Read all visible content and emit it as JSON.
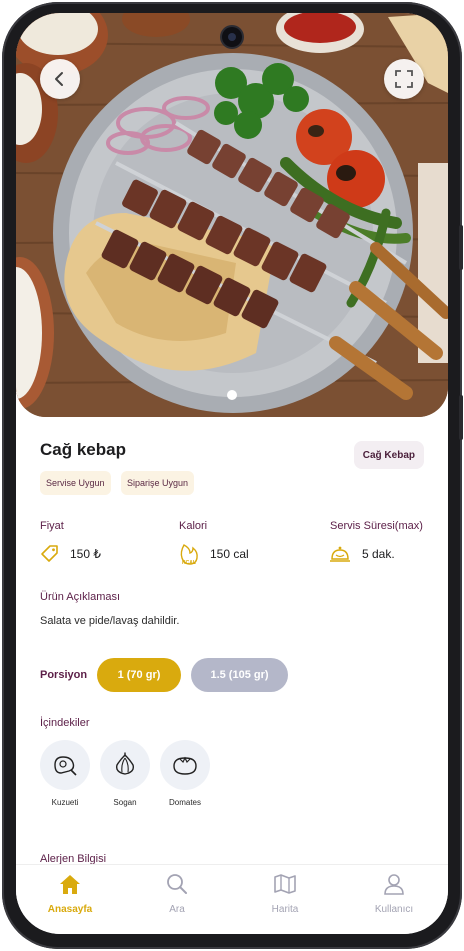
{
  "product": {
    "name": "Cağ kebap",
    "category": "Cağ Kebap",
    "tags": [
      "Servise Uygun",
      "Siparişe Uygun"
    ]
  },
  "info": {
    "price_label": "Fiyat",
    "price_value": "150 ₺",
    "calorie_label": "Kalori",
    "calorie_value": "150 cal",
    "calorie_icon_text": "KCAL",
    "time_label": "Servis Süresi(max)",
    "time_value": "5 dak."
  },
  "description": {
    "label": "Ürün Açıklaması",
    "text": "Salata ve pide/lavaş dahildir."
  },
  "portion": {
    "label": "Porsiyon",
    "options": [
      "1 (70 gr)",
      "1.5 (105 gr)"
    ],
    "selected": "1 (70 gr)"
  },
  "ingredients": {
    "label": "İçindekiler",
    "items": [
      {
        "name": "Kuzueti",
        "icon": "meat-icon"
      },
      {
        "name": "Sogan",
        "icon": "onion-icon"
      },
      {
        "name": "Domates",
        "icon": "tomato-icon"
      }
    ]
  },
  "allergen": {
    "label": "Alerjen Bilgisi"
  },
  "nav": {
    "items": [
      {
        "label": "Anasayfa",
        "icon": "home-icon",
        "active": true
      },
      {
        "label": "Ara",
        "icon": "search-icon",
        "active": false
      },
      {
        "label": "Harita",
        "icon": "map-icon",
        "active": false
      },
      {
        "label": "Kullanıcı",
        "icon": "user-icon",
        "active": false
      }
    ]
  },
  "colors": {
    "accent": "#d9aa0e",
    "brand": "#5b1e47",
    "inactive_pill": "#b4b7c9",
    "nav_inactive": "#a3a3b3"
  }
}
